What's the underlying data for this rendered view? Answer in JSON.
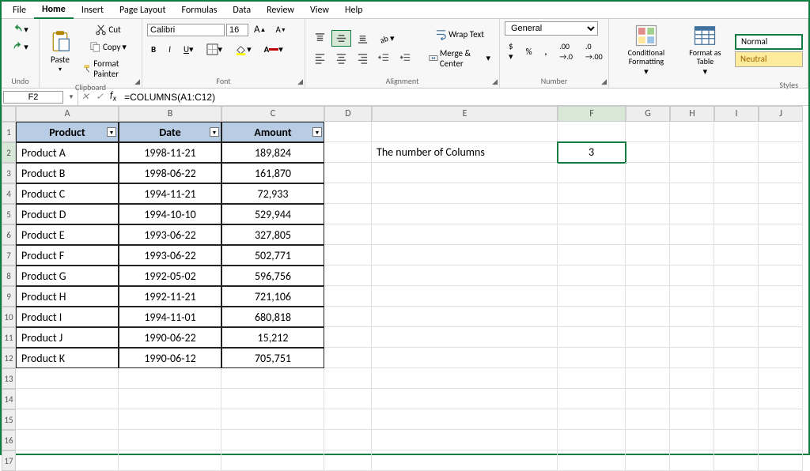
{
  "menu": [
    "File",
    "Home",
    "Insert",
    "Page Layout",
    "Formulas",
    "Data",
    "Review",
    "View",
    "Help"
  ],
  "active_menu_index": 1,
  "ribbon": {
    "undo": "Undo",
    "clipboard": {
      "label": "Clipboard",
      "paste": "Paste",
      "cut": "Cut",
      "copy": "Copy",
      "format_painter": "Format Painter"
    },
    "font": {
      "label": "Font",
      "name": "Calibri",
      "size": "16"
    },
    "alignment": {
      "label": "Alignment",
      "wrap": "Wrap Text",
      "merge": "Merge & Center"
    },
    "number": {
      "label": "Number",
      "format": "General"
    },
    "cond_fmt": "Conditional Formatting",
    "fmt_table": "Format as Table",
    "styles": {
      "label": "Styles",
      "normal": "Normal",
      "neutral": "Neutral"
    }
  },
  "name_box": "F2",
  "formula_bar": "=COLUMNS(A1:C12)",
  "columns": [
    "A",
    "B",
    "C",
    "D",
    "E",
    "F",
    "G",
    "H",
    "I",
    "J"
  ],
  "selected_col": "F",
  "selected_row": 2,
  "row_count": 17,
  "table": {
    "headers": [
      "Product",
      "Date",
      "Amount"
    ],
    "rows": [
      [
        "Product A",
        "1998-11-21",
        "189,824"
      ],
      [
        "Product B",
        "1998-06-22",
        "161,870"
      ],
      [
        "Product C",
        "1994-11-21",
        "72,933"
      ],
      [
        "Product D",
        "1994-10-10",
        "529,944"
      ],
      [
        "Product E",
        "1993-06-22",
        "327,805"
      ],
      [
        "Product F",
        "1993-06-22",
        "502,771"
      ],
      [
        "Product G",
        "1992-05-02",
        "596,756"
      ],
      [
        "Product H",
        "1992-11-21",
        "721,106"
      ],
      [
        "Product I",
        "1994-11-01",
        "680,818"
      ],
      [
        "Product J",
        "1990-06-22",
        "15,212"
      ],
      [
        "Product K",
        "1990-06-12",
        "705,751"
      ]
    ]
  },
  "note": {
    "label": "The number of Columns",
    "value": "3"
  }
}
